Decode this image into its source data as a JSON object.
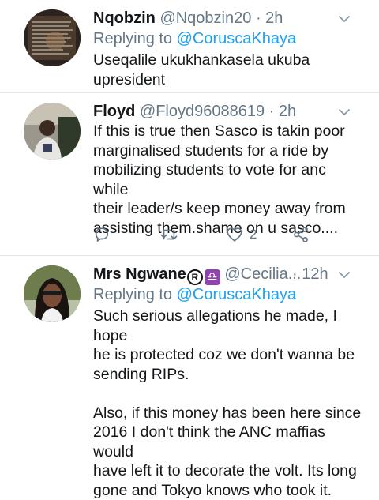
{
  "tweets": [
    {
      "name": "Nqobzin",
      "handle": "@Nqobzin20",
      "time": "· 2h",
      "replying_prefix": "Replying to ",
      "replying_to": "@CoruscaKhaya",
      "text": "Useqalile ukukhankasela ukuba\nupresident"
    },
    {
      "name": "Floyd",
      "handle": "@Floyd96088619",
      "time": "· 2h",
      "text": "If this is true then Sasco is takin poor\nmarginalised students for a ride by\nmobilizing students to vote for anc while\ntheir leader/s keep money away from\nassisting them.shame on u sasco....",
      "like_count": "2"
    },
    {
      "name": "Mrs Ngwane",
      "name_badge": "♎",
      "name_reg": "R",
      "handle": "@Cecilia...",
      "time": "· 12h",
      "replying_prefix": "Replying to ",
      "replying_to": "@CoruscaKhaya",
      "text": "Such serious allegations he made, I hope\nhe is protected coz we don't wanna be\nsending RIPs.\n\nAlso, if this money has been here since\n2016 I don't think the ANC maffias would\nhave left it to decorate the volt. Its long\ngone and Tokyo knows who took it."
    }
  ],
  "icons": {
    "reply": "reply-icon",
    "retweet": "retweet-icon",
    "like": "heart-icon",
    "share": "share-icon",
    "more": "chevron-down-icon"
  },
  "colors": {
    "link": "#1da1f2",
    "secondary_text": "#657786",
    "divider": "#e1e8ed"
  }
}
